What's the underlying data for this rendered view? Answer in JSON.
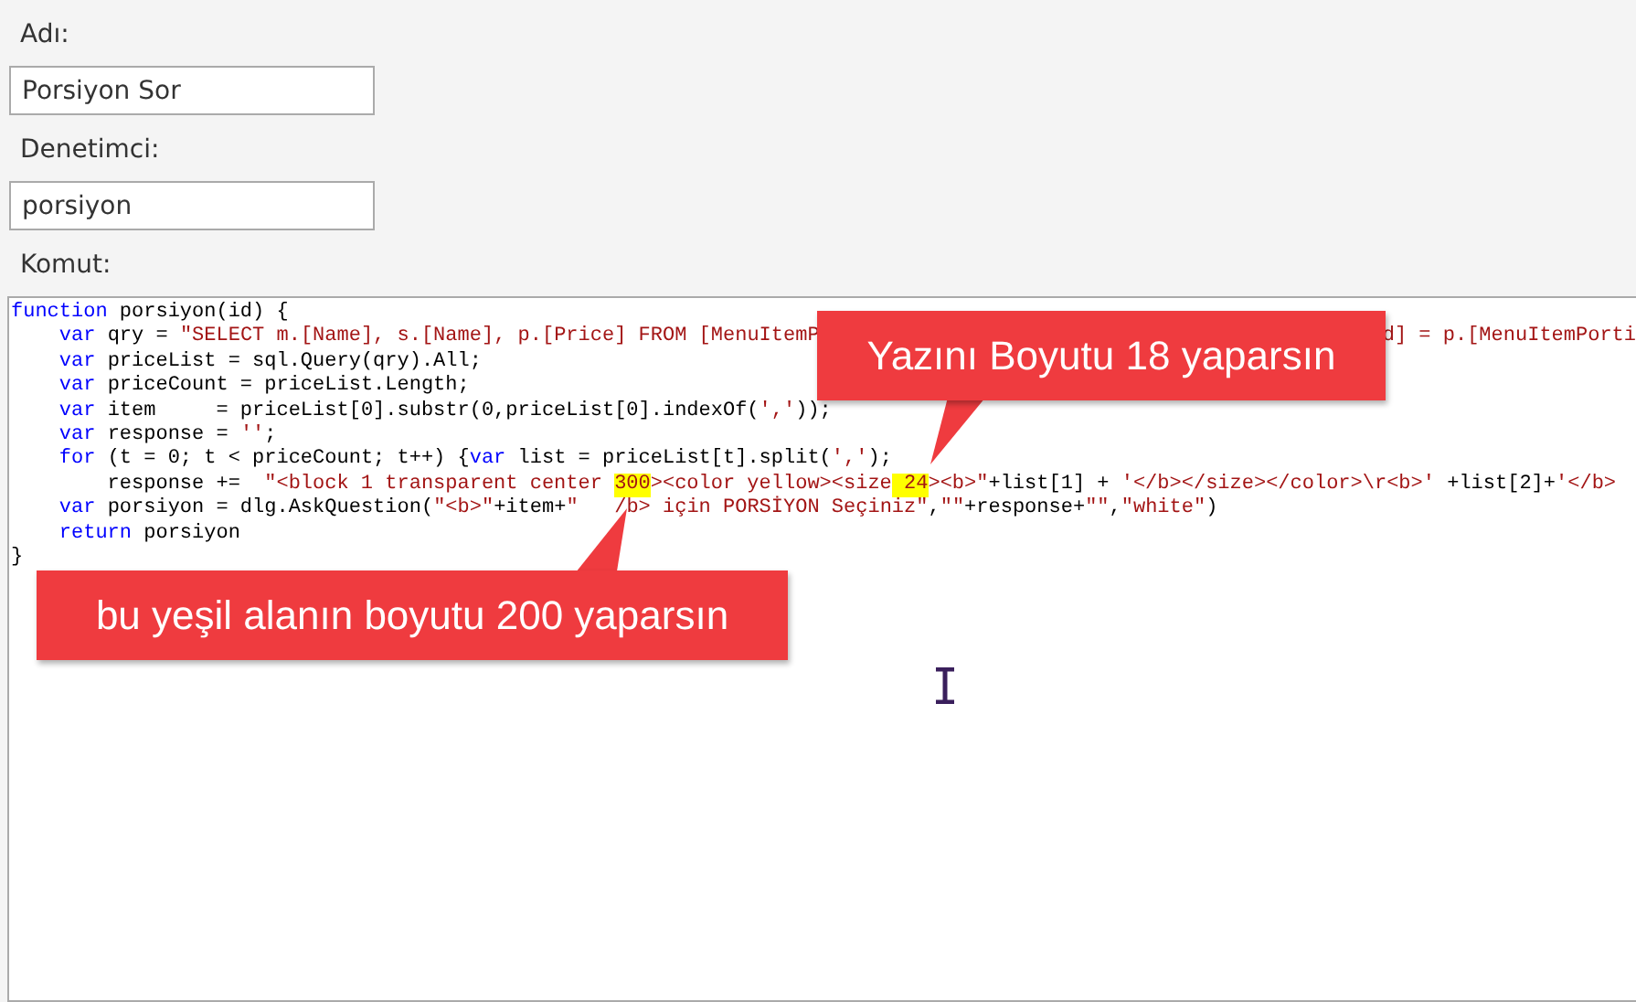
{
  "fields": [
    {
      "label": "Adı:",
      "value": "Porsiyon Sor"
    },
    {
      "label": "Denetimci:",
      "value": "porsiyon"
    }
  ],
  "command_label": "Komut:",
  "code_lines": [
    [
      {
        "text": "function",
        "kind": "keyword"
      },
      {
        "text": " porsiyon(id) {",
        "kind": "plain"
      }
    ],
    [
      {
        "text": "    var",
        "kind": "keyword"
      },
      {
        "text": " qry = ",
        "kind": "plain"
      },
      {
        "text": "\"SELECT m.[Name], s.[Name], p.[Price] FROM [MenuItemP",
        "kind": "string"
      },
      {
        "text": "d] = p.[MenuItemPorti",
        "kind": "string",
        "covered_before": true
      }
    ],
    [
      {
        "text": "    var",
        "kind": "keyword"
      },
      {
        "text": " priceList = sql.Query(qry).All;",
        "kind": "plain"
      }
    ],
    [
      {
        "text": "    var",
        "kind": "keyword"
      },
      {
        "text": " priceCount = priceList.Length;",
        "kind": "plain"
      }
    ],
    [
      {
        "text": "    var",
        "kind": "keyword"
      },
      {
        "text": " item     = priceList[0].substr(0,priceList[0].indexOf(",
        "kind": "plain"
      },
      {
        "text": "','",
        "kind": "string"
      },
      {
        "text": "));",
        "kind": "plain"
      }
    ],
    [
      {
        "text": "    var",
        "kind": "keyword"
      },
      {
        "text": " response = ",
        "kind": "plain"
      },
      {
        "text": "''",
        "kind": "string"
      },
      {
        "text": ";",
        "kind": "plain"
      }
    ],
    [
      {
        "text": "    for",
        "kind": "keyword"
      },
      {
        "text": " (t = 0; t < priceCount; t++) {",
        "kind": "plain"
      },
      {
        "text": "var",
        "kind": "keyword"
      },
      {
        "text": " list = priceList[t].split(",
        "kind": "plain"
      },
      {
        "text": "','",
        "kind": "string"
      },
      {
        "text": ");",
        "kind": "plain"
      }
    ],
    [
      {
        "text": "        response +=  ",
        "kind": "plain"
      },
      {
        "text": "\"<block 1 transparent center ",
        "kind": "string"
      },
      {
        "text": "300",
        "kind": "highlight"
      },
      {
        "text": "><color yellow><size",
        "kind": "string"
      },
      {
        "text": " 24",
        "kind": "highlight"
      },
      {
        "text": "><b>\"",
        "kind": "string"
      },
      {
        "text": "+list[1] + ",
        "kind": "plain"
      },
      {
        "text": "'</b></size></color>\\r<b>'",
        "kind": "string"
      },
      {
        "text": " +list[2]+",
        "kind": "plain"
      },
      {
        "text": "'</b>",
        "kind": "string"
      }
    ],
    [
      {
        "text": "    var",
        "kind": "keyword"
      },
      {
        "text": " porsiyon = dlg.AskQuestion(",
        "kind": "plain"
      },
      {
        "text": "\"<b>\"",
        "kind": "string"
      },
      {
        "text": "+item+",
        "kind": "plain"
      },
      {
        "text": "\"",
        "kind": "string"
      },
      {
        "text": "/b> için PORSİYON Seçiniz\"",
        "kind": "string",
        "covered_before": true
      },
      {
        "text": ",",
        "kind": "plain"
      },
      {
        "text": "\"\"",
        "kind": "string"
      },
      {
        "text": "+response+",
        "kind": "plain"
      },
      {
        "text": "\"\"",
        "kind": "string"
      },
      {
        "text": ",",
        "kind": "plain"
      },
      {
        "text": "\"white\"",
        "kind": "string"
      },
      {
        "text": ")",
        "kind": "plain"
      }
    ],
    [
      {
        "text": "    return",
        "kind": "keyword"
      },
      {
        "text": " porsiyon",
        "kind": "plain"
      }
    ],
    [
      {
        "text": "}",
        "kind": "plain"
      }
    ]
  ],
  "callouts": [
    {
      "text": "Yazını Boyutu 18 yaparsın",
      "kind": "top"
    },
    {
      "text": "bu yeşil alanın boyutu 200 yaparsın",
      "kind": "bottom"
    }
  ]
}
